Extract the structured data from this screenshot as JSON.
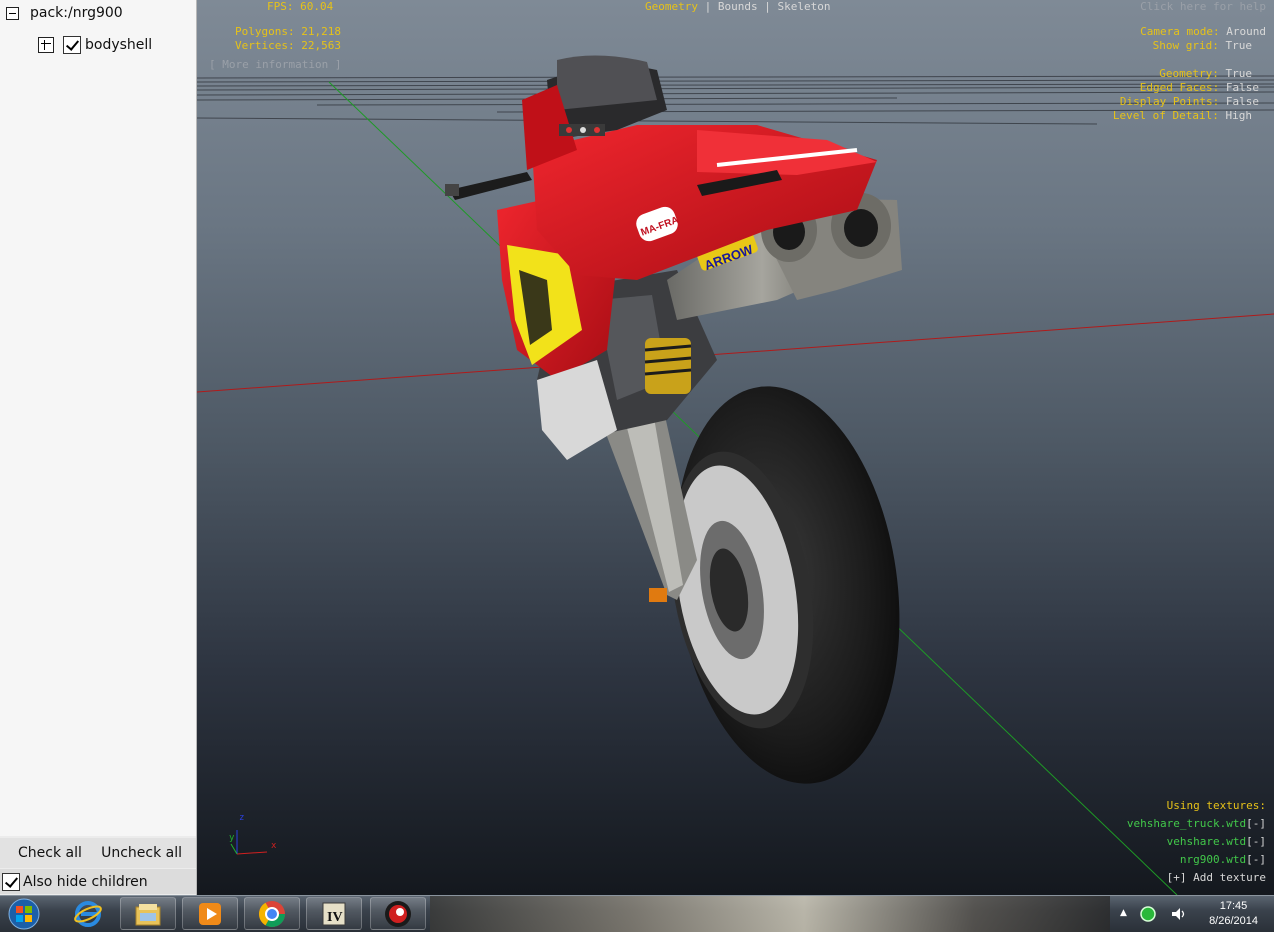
{
  "tree": {
    "root_label": "pack:/nrg900",
    "child_label": "bodyshell"
  },
  "panel": {
    "check_all": "Check all",
    "uncheck_all": "Uncheck all",
    "also_hide_children": "Also hide children"
  },
  "viewport": {
    "fps_label": "FPS:",
    "fps_value": "60.04",
    "polygons_label": "Polygons:",
    "polygons_value": "21,218",
    "vertices_label": "Vertices:",
    "vertices_value": "22,563",
    "more_info": "[ More information ]",
    "tabs": [
      "Geometry",
      "Bounds",
      "Skeleton"
    ],
    "help": "Click here for help",
    "camera_mode_label": "Camera mode:",
    "camera_mode_value": "Around",
    "show_grid_label": "Show grid:",
    "show_grid_value": "True",
    "geometry_label": "Geometry:",
    "geometry_value": "True",
    "edged_faces_label": "Edged Faces:",
    "edged_faces_value": "False",
    "display_points_label": "Display Points:",
    "display_points_value": "False",
    "lod_label": "Level of Detail:",
    "lod_value": "High",
    "using_textures": "Using textures:",
    "textures": [
      "vehshare_truck.wtd",
      "vehshare.wtd",
      "nrg900.wtd"
    ],
    "remove_label": "[-]",
    "add_texture": "[+] Add texture",
    "axis_x": "x",
    "axis_y": "y",
    "axis_z": "z",
    "decals": {
      "sponsor_left": "MA-FRA",
      "sponsor_exhaust": "ARROW"
    }
  },
  "taskbar": {
    "app_icons": [
      "windows-explorer-icon",
      "media-player-icon",
      "chrome-icon",
      "gta-iv-icon",
      "openiv-icon"
    ],
    "time": "17:45",
    "date": "8/26/2014"
  },
  "colors": {
    "hud_yellow": "#e6c219",
    "hud_green": "#42c84a",
    "bike_red": "#d8141e",
    "bike_yellow": "#f2e21a"
  }
}
